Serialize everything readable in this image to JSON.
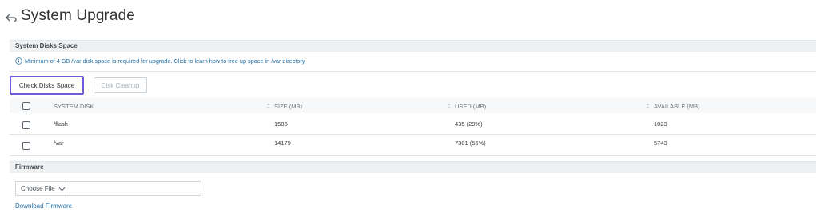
{
  "header": {
    "back_icon": "back-arrow-icon",
    "title": "System Upgrade"
  },
  "disks_section": {
    "title": "System Disks Space",
    "info_icon": "info-circle-icon",
    "info_text": "Minimum of 4 GB /var disk space is required for upgrade. Click to learn how to free up space in /var directory.",
    "check_button_label": "Check Disks Space",
    "cleanup_button_label": "Disk Cleanup",
    "columns": [
      "SYSTEM DISK",
      "SIZE (MB)",
      "USED (MB)",
      "AVAILABLE (MB)"
    ],
    "rows": [
      {
        "disk": "/flash",
        "size": "1585",
        "used": "435 (29%)",
        "available": "1023"
      },
      {
        "disk": "/var",
        "size": "14179",
        "used": "7301 (55%)",
        "available": "5743"
      }
    ]
  },
  "firmware_section": {
    "title": "Firmware",
    "choose_file_label": "Choose File",
    "choose_file_icon": "chevron-down-icon",
    "selected_file": "",
    "download_link": "Download Firmware"
  },
  "colors": {
    "accent_border": "#6e5bd9",
    "link": "#1f6ea6",
    "section_bar": "#eef0f2"
  }
}
